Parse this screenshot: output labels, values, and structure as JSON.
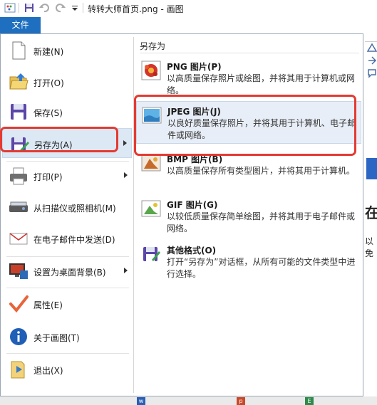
{
  "window": {
    "title": "转转大师首页.png - 画图",
    "file_tab": "文件"
  },
  "menu_left": [
    {
      "label": "新建(N)",
      "icon": "new-document-icon"
    },
    {
      "label": "打开(O)",
      "icon": "open-folder-icon"
    },
    {
      "label": "保存(S)",
      "icon": "save-disk-icon"
    },
    {
      "label": "另存为(A)",
      "icon": "save-as-icon",
      "selected": true,
      "submenu": true
    },
    {
      "label": "打印(P)",
      "icon": "printer-icon",
      "submenu": true
    },
    {
      "label": "从扫描仪或照相机(M)",
      "icon": "scanner-icon"
    },
    {
      "label": "在电子邮件中发送(D)",
      "icon": "email-icon"
    },
    {
      "label": "设置为桌面背景(B)",
      "icon": "desktop-background-icon",
      "submenu": true
    },
    {
      "label": "属性(E)",
      "icon": "checkmark-icon"
    },
    {
      "label": "关于画图(T)",
      "icon": "info-icon"
    },
    {
      "label": "退出(X)",
      "icon": "exit-icon"
    }
  ],
  "save_as_pane": {
    "title": "另存为",
    "options": [
      {
        "title": "PNG 图片(P)",
        "desc": "以高质量保存照片或绘图，并将其用于计算机或网络。",
        "icon": "png-image-icon"
      },
      {
        "title": "JPEG 图片(J)",
        "desc": "以良好质量保存照片，并将其用于计算机、电子邮件或网络。",
        "icon": "jpeg-image-icon",
        "highlighted": true
      },
      {
        "title": "BMP 图片(B)",
        "desc": "以高质量保存所有类型图片，并将其用于计算机。",
        "icon": "bmp-image-icon"
      },
      {
        "title": "GIF 图片(G)",
        "desc": "以较低质量保存简单绘图，并将其用于电子邮件或网络。",
        "icon": "gif-image-icon"
      },
      {
        "title": "其他格式(O)",
        "desc": "打开“另存为”对话框，从所有可能的文件类型中进行选择。",
        "icon": "other-formats-icon"
      }
    ]
  },
  "background": {
    "partial_char_1": "在",
    "partial_char_2": "以免"
  },
  "colors": {
    "accent": "#1e6fbf",
    "annotation_red": "#e43a32",
    "selected_bg": "#dde8f5"
  }
}
